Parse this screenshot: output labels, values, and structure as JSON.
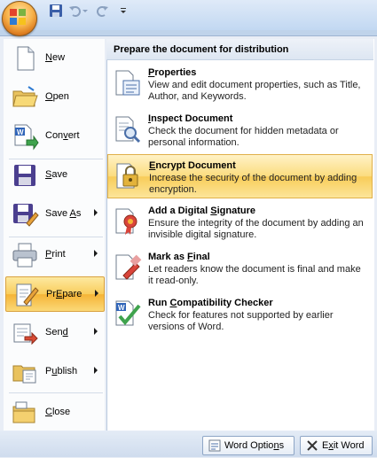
{
  "menu": {
    "items": [
      {
        "label": "New",
        "accel": "N",
        "pre": "",
        "post": "ew",
        "icon": "new-document-icon"
      },
      {
        "label": "Open",
        "accel": "O",
        "pre": "",
        "post": "pen",
        "icon": "open-folder-icon"
      },
      {
        "label": "Convert",
        "accel": "v",
        "pre": "Con",
        "post": "ert",
        "icon": "convert-icon"
      },
      {
        "label": "Save",
        "accel": "S",
        "pre": "",
        "post": "ave",
        "icon": "save-icon"
      },
      {
        "label": "Save As",
        "accel": "A",
        "pre": "Save ",
        "post": "s",
        "icon": "save-as-icon"
      },
      {
        "label": "Print",
        "accel": "P",
        "pre": "",
        "post": "rint",
        "icon": "printer-icon"
      },
      {
        "label": "Prepare",
        "accel": "E",
        "pre": "Pr",
        "post": "pare",
        "icon": "prepare-icon"
      },
      {
        "label": "Send",
        "accel": "d",
        "pre": "Sen",
        "post": "",
        "icon": "send-icon"
      },
      {
        "label": "Publish",
        "accel": "u",
        "pre": "P",
        "post": "blish",
        "icon": "publish-icon"
      },
      {
        "label": "Close",
        "accel": "C",
        "pre": "",
        "post": "lose",
        "icon": "close-folder-icon"
      }
    ]
  },
  "panel": {
    "header": "Prepare the document for distribution",
    "items": [
      {
        "pre": "",
        "accel": "P",
        "post": "roperties",
        "title": "Properties",
        "desc": "View and edit document properties, such as Title, Author, and Keywords.",
        "icon": "properties-icon"
      },
      {
        "pre": "",
        "accel": "I",
        "post": "nspect Document",
        "title": "Inspect Document",
        "desc": "Check the document for hidden metadata or personal information.",
        "icon": "inspect-document-icon"
      },
      {
        "pre": "",
        "accel": "E",
        "post": "ncrypt Document",
        "title": "Encrypt Document",
        "desc": "Increase the security of the document by adding encryption.",
        "icon": "encrypt-lock-icon"
      },
      {
        "pre": "Add a Digital ",
        "accel": "S",
        "post": "ignature",
        "title": "Add a Digital Signature",
        "desc": "Ensure the integrity of the document by adding an invisible digital signature.",
        "icon": "digital-signature-icon"
      },
      {
        "pre": "Mark as ",
        "accel": "F",
        "post": "inal",
        "title": "Mark as Final",
        "desc": "Let readers know the document is final and make it read-only.",
        "icon": "mark-final-icon"
      },
      {
        "pre": "Run ",
        "accel": "C",
        "post": "ompatibility Checker",
        "title": "Run Compatibility Checker",
        "desc": "Check for features not supported by earlier versions of Word.",
        "icon": "compatibility-checker-icon"
      }
    ]
  },
  "footer": {
    "options": {
      "pre": "Word Optio",
      "accel": "n",
      "post": "s"
    },
    "exit": {
      "pre": "E",
      "accel": "x",
      "post": "it Word"
    }
  },
  "colors": {
    "accent": "#f8cc58",
    "frame": "#bfd3ea"
  }
}
